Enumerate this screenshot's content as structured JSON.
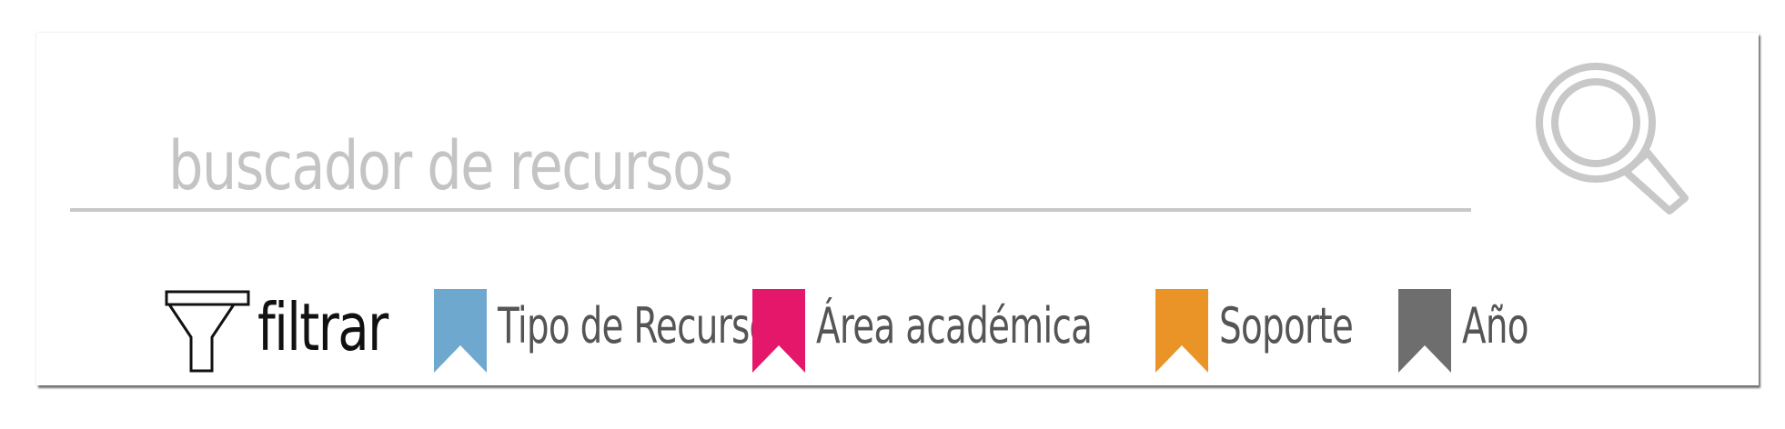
{
  "search": {
    "placeholder": "buscador de recursos",
    "icon": "search-icon",
    "icon_color": "#c8c8c8"
  },
  "filter": {
    "label": "filtrar",
    "icon": "funnel-icon"
  },
  "chips": [
    {
      "label": "Tipo de Recurso",
      "color": "#6fa8cf"
    },
    {
      "label": "Área académica",
      "color": "#e5176a"
    },
    {
      "label": "Soporte",
      "color": "#ea9427"
    },
    {
      "label": "Año",
      "color": "#6e6e6e"
    }
  ],
  "colors": {
    "text_muted": "#c4c4c4",
    "chip_text": "#555555",
    "filter_text": "#111111"
  }
}
